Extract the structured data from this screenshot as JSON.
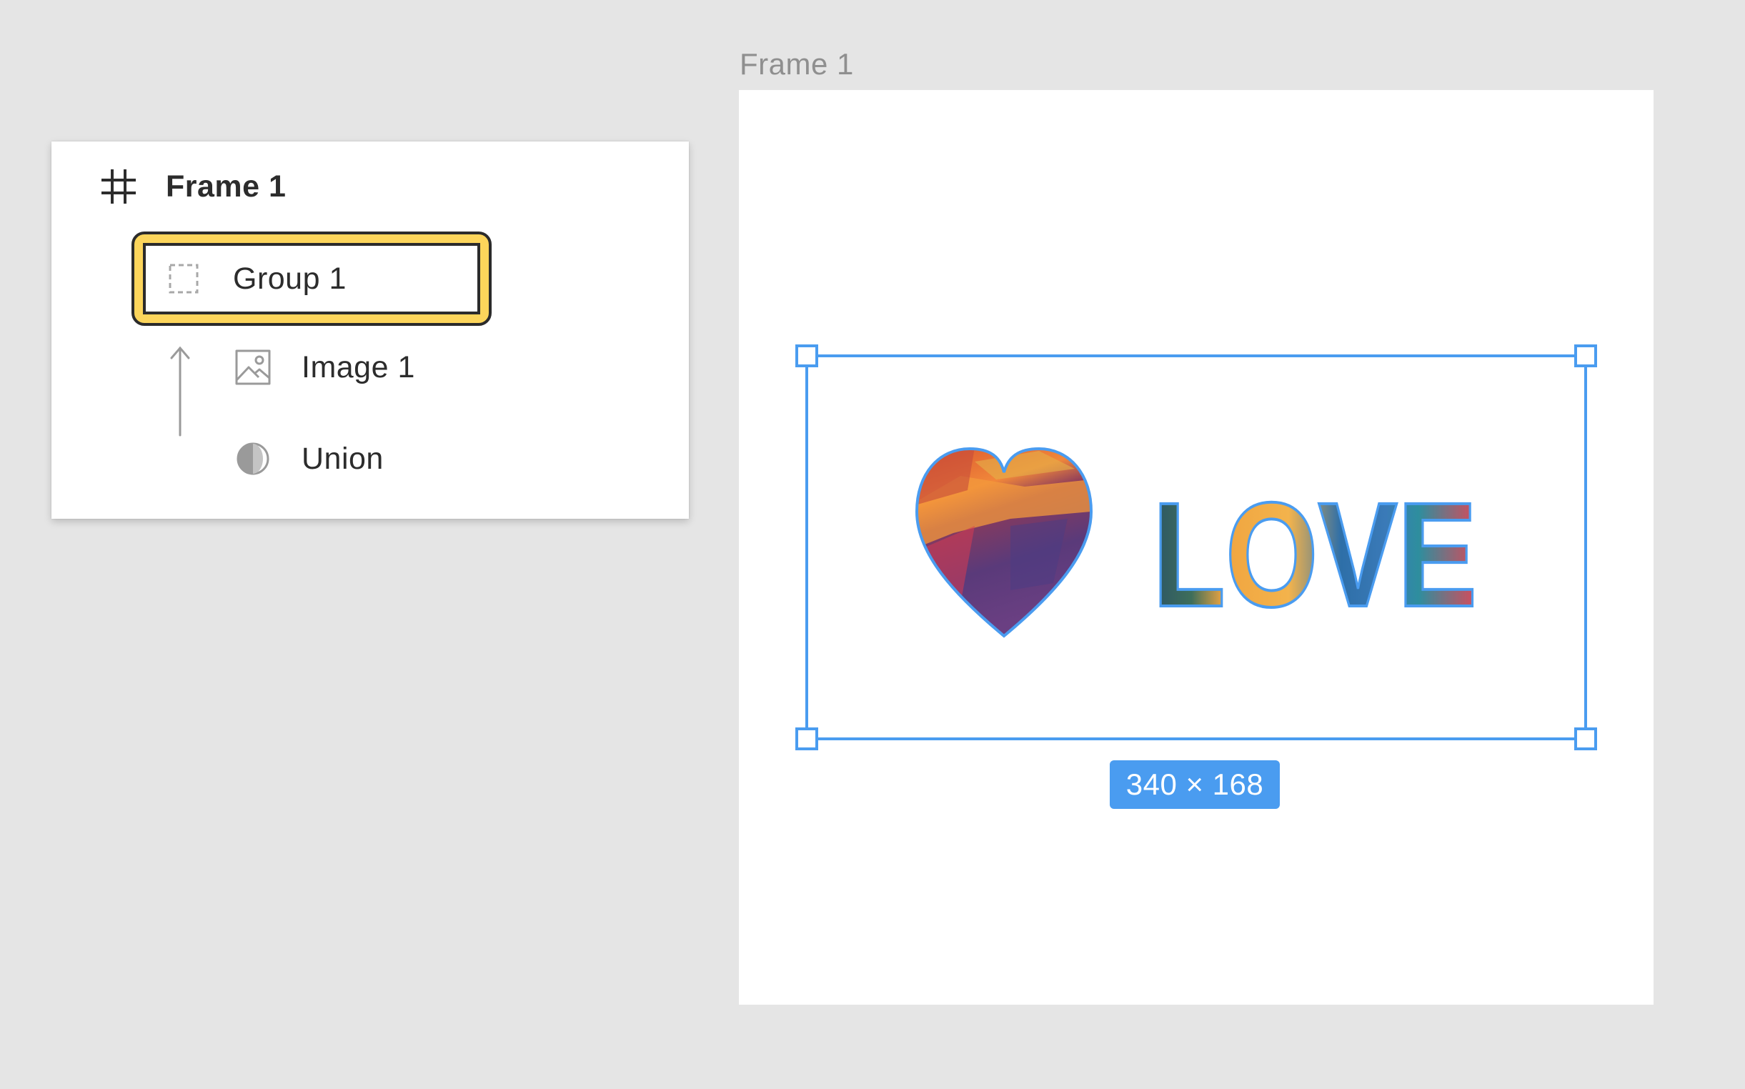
{
  "layers_panel": {
    "frame": {
      "label": "Frame 1",
      "icon": "frame-hash-icon"
    },
    "group": {
      "label": "Group 1",
      "icon": "group-dashed-icon"
    },
    "image": {
      "label": "Image 1",
      "icon": "image-icon"
    },
    "union": {
      "label": "Union",
      "icon": "boolean-union-icon"
    },
    "mask_indicator": "mask-arrow-icon"
  },
  "canvas": {
    "frame_title": "Frame 1",
    "artwork_text": "LOVE",
    "selection_size": "340 × 168"
  },
  "colors": {
    "canvas_bg": "#e5e5e5",
    "selection_blue": "#4a9cf0",
    "highlight_yellow": "#fcd55b"
  }
}
